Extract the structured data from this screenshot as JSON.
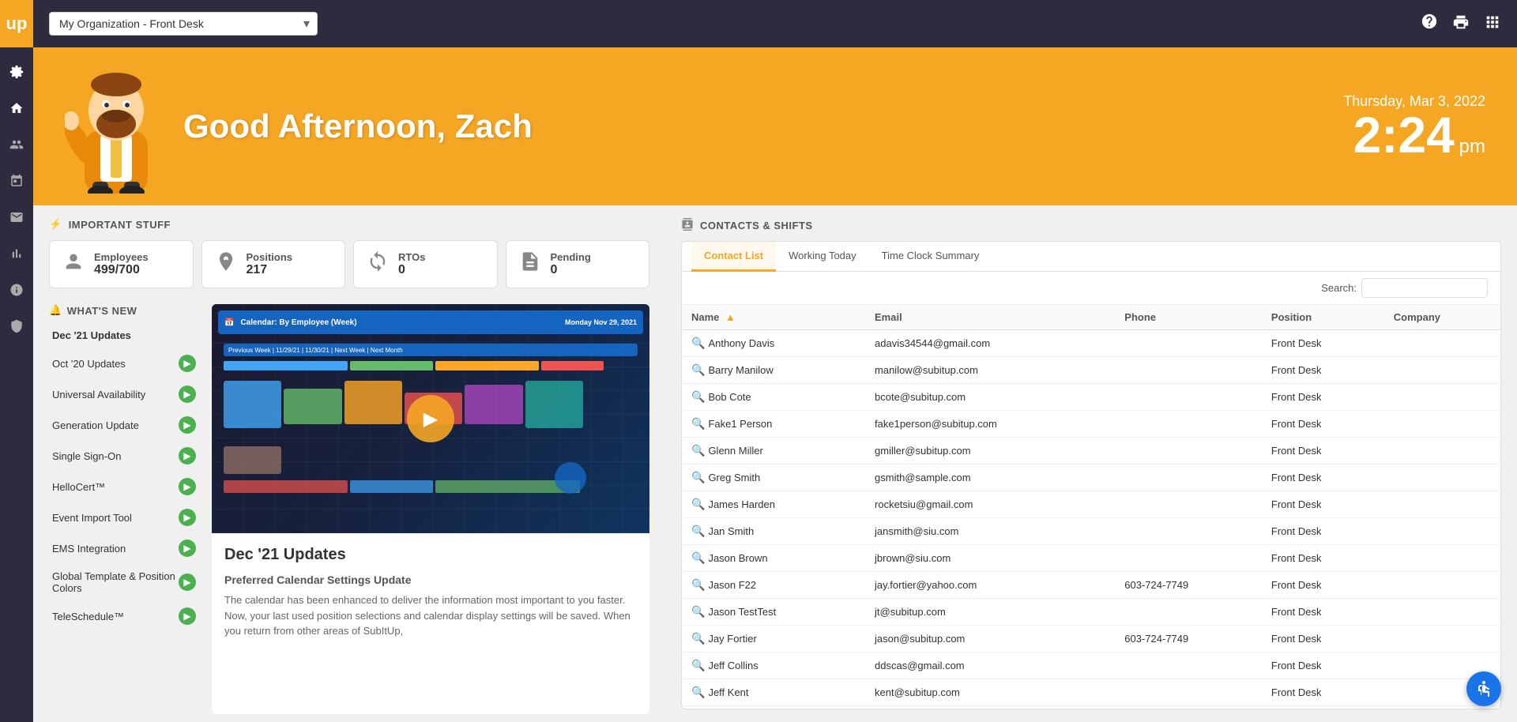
{
  "sidebar": {
    "logo": "up",
    "items": [
      {
        "name": "settings-icon",
        "icon": "⚙",
        "active": false
      },
      {
        "name": "home-icon",
        "icon": "⌂",
        "active": true
      },
      {
        "name": "people-icon",
        "icon": "👥",
        "active": false
      },
      {
        "name": "calendar-icon",
        "icon": "📅",
        "active": false
      },
      {
        "name": "mail-icon",
        "icon": "✉",
        "active": false
      },
      {
        "name": "chart-icon",
        "icon": "📊",
        "active": false
      },
      {
        "name": "info-icon",
        "icon": "ℹ",
        "active": false
      },
      {
        "name": "shield-icon",
        "icon": "🛡",
        "active": false
      }
    ]
  },
  "topbar": {
    "org_label": "My Organization - Front Desk",
    "icons": [
      "?",
      "🖨",
      "⊞"
    ]
  },
  "hero": {
    "greeting": "Good Afternoon, Zach",
    "date": "Thursday, Mar 3, 2022",
    "time": "2:24",
    "ampm": "pm"
  },
  "important": {
    "title": "IMPORTANT STUFF",
    "stats": [
      {
        "label": "Employees",
        "value": "499/700",
        "icon": "👤"
      },
      {
        "label": "Positions",
        "value": "217",
        "icon": "🎯"
      },
      {
        "label": "RTOs",
        "value": "0",
        "icon": "↻"
      },
      {
        "label": "Pending",
        "value": "0",
        "icon": "📋"
      }
    ]
  },
  "whatsnew": {
    "title": "WHAT'S NEW",
    "bell_icon": "🔔",
    "items": [
      {
        "label": "Dec '21 Updates",
        "active": true,
        "has_arrow": false
      },
      {
        "label": "Oct '20 Updates",
        "active": false,
        "has_arrow": true
      },
      {
        "label": "Universal Availability",
        "active": false,
        "has_arrow": true
      },
      {
        "label": "Generation Update",
        "active": false,
        "has_arrow": true
      },
      {
        "label": "Single Sign-On",
        "active": false,
        "has_arrow": true
      },
      {
        "label": "HelloCert™",
        "active": false,
        "has_arrow": true
      },
      {
        "label": "Event Import Tool",
        "active": false,
        "has_arrow": true
      },
      {
        "label": "EMS Integration",
        "active": false,
        "has_arrow": true
      },
      {
        "label": "Global Template & Position Colors",
        "active": false,
        "has_arrow": true
      },
      {
        "label": "TeleSchedule™",
        "active": false,
        "has_arrow": true
      }
    ],
    "selected_title": "Dec '21 Updates",
    "selected_subtitle": "Preferred Calendar Settings Update",
    "selected_body": "The calendar has been enhanced to deliver the information most important to you faster. Now, your last used position selections and calendar display settings will be saved. When you return from other areas of SubItUp,"
  },
  "contacts": {
    "section_title": "CONTACTS & SHIFTS",
    "tabs": [
      {
        "label": "Contact List",
        "active": true
      },
      {
        "label": "Working Today",
        "active": false
      },
      {
        "label": "Time Clock Summary",
        "active": false
      }
    ],
    "search_label": "Search:",
    "search_placeholder": "",
    "columns": [
      {
        "label": "Name",
        "sortable": true
      },
      {
        "label": "Email",
        "sortable": false
      },
      {
        "label": "Phone",
        "sortable": false
      },
      {
        "label": "Position",
        "sortable": false
      },
      {
        "label": "Company",
        "sortable": false
      }
    ],
    "rows": [
      {
        "name": "Anthony Davis",
        "email": "adavis34544@gmail.com",
        "phone": "",
        "position": "Front Desk",
        "company": ""
      },
      {
        "name": "Barry Manilow",
        "email": "manilow@subitup.com",
        "phone": "",
        "position": "Front Desk",
        "company": ""
      },
      {
        "name": "Bob Cote",
        "email": "bcote@subitup.com",
        "phone": "",
        "position": "Front Desk",
        "company": ""
      },
      {
        "name": "Fake1 Person",
        "email": "fake1person@subitup.com",
        "phone": "",
        "position": "Front Desk",
        "company": ""
      },
      {
        "name": "Glenn Miller",
        "email": "gmiller@subitup.com",
        "phone": "",
        "position": "Front Desk",
        "company": ""
      },
      {
        "name": "Greg Smith",
        "email": "gsmith@sample.com",
        "phone": "",
        "position": "Front Desk",
        "company": ""
      },
      {
        "name": "James Harden",
        "email": "rocketsiu@gmail.com",
        "phone": "",
        "position": "Front Desk",
        "company": ""
      },
      {
        "name": "Jan Smith",
        "email": "jansmith@siu.com",
        "phone": "",
        "position": "Front Desk",
        "company": ""
      },
      {
        "name": "Jason Brown",
        "email": "jbrown@siu.com",
        "phone": "",
        "position": "Front Desk",
        "company": ""
      },
      {
        "name": "Jason F22",
        "email": "jay.fortier@yahoo.com",
        "phone": "603-724-7749",
        "position": "Front Desk",
        "company": ""
      },
      {
        "name": "Jason TestTest",
        "email": "jt@subitup.com",
        "phone": "",
        "position": "Front Desk",
        "company": ""
      },
      {
        "name": "Jay Fortier",
        "email": "jason@subitup.com",
        "phone": "603-724-7749",
        "position": "Front Desk",
        "company": ""
      },
      {
        "name": "Jeff Collins",
        "email": "ddscas@gmail.com",
        "phone": "",
        "position": "Front Desk",
        "company": ""
      },
      {
        "name": "Jeff Kent",
        "email": "kent@subitup.com",
        "phone": "",
        "position": "Front Desk",
        "company": ""
      }
    ]
  },
  "colors": {
    "accent": "#f5a623",
    "sidebar_bg": "#2c2c3e",
    "active_tab": "#f5a623",
    "arrow_green": "#4caf50",
    "link_blue": "#1a73e8"
  }
}
